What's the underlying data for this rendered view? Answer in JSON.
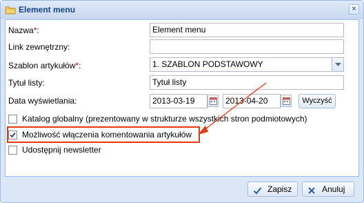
{
  "window": {
    "title": "Element menu"
  },
  "form": {
    "name": {
      "label": "Nazwa",
      "required_mark": "*",
      "colon": ":",
      "value": "Element menu"
    },
    "external_link": {
      "label": "Link zewnętrzny:",
      "value": ""
    },
    "template": {
      "label": "Szablon artykułów",
      "required_mark": "*",
      "colon": ":",
      "value": "1. SZABLON PODSTAWOWY"
    },
    "list_title": {
      "label": "Tytuł listy:",
      "value": "Tytuł listy"
    },
    "display_date": {
      "label": "Data wyświetlania:",
      "from": "2013-03-19",
      "to": "2013-04-20",
      "clear_label": "Wyczyść"
    },
    "global_catalog": {
      "label": "Katalog globalny (prezentowany w strukturze wszystkich stron podmiotowych)",
      "checked": false
    },
    "comments": {
      "label": "Możliwość włączenia komentowania artykułów",
      "checked": true
    },
    "newsletter": {
      "label": "Udostępnij newsletter",
      "checked": false
    }
  },
  "footer": {
    "save_label": "Zapisz",
    "cancel_label": "Anuluj"
  },
  "colors": {
    "annotation": "#e8380d",
    "title_text": "#15428b",
    "window_bg": "#dbe7f6",
    "border": "#99bbe8"
  },
  "icons": [
    "folder-icon",
    "close-icon",
    "calendar-icon",
    "chevron-down-icon",
    "checkmark-icon",
    "cancel-icon"
  ]
}
